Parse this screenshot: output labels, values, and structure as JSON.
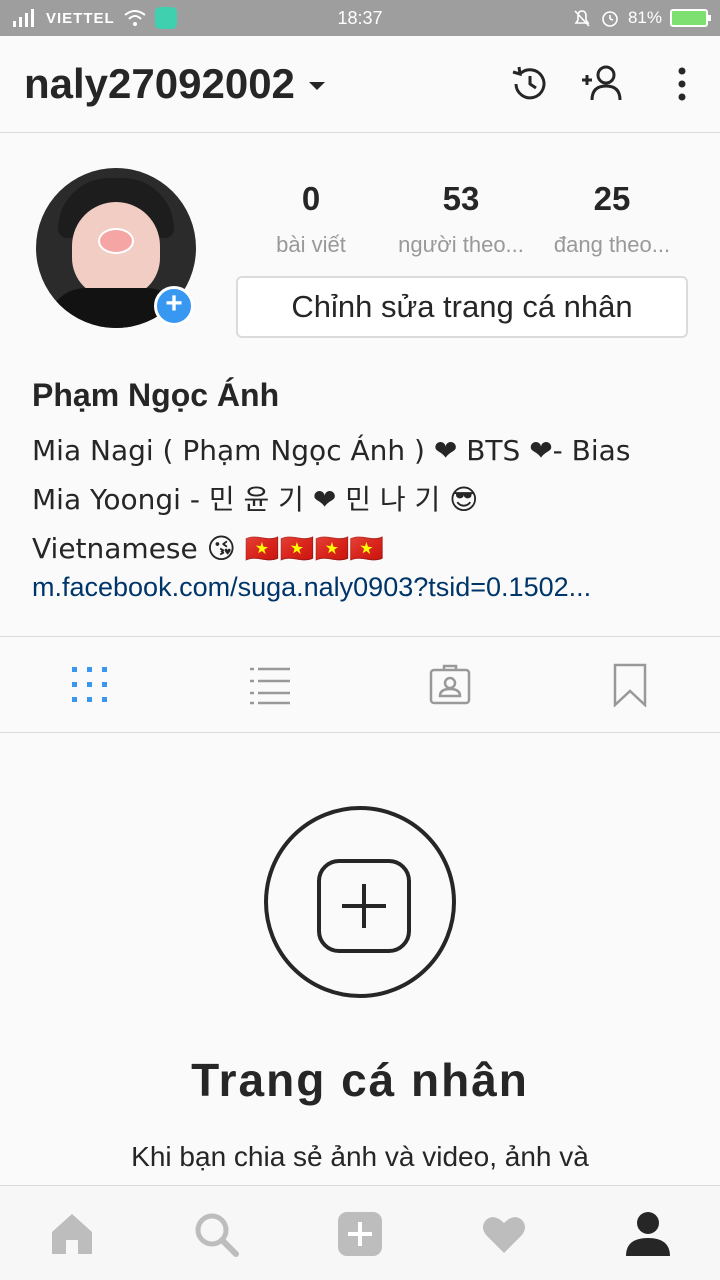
{
  "status_bar": {
    "carrier": "VIETTEL",
    "time": "18:37",
    "battery": "81%"
  },
  "header": {
    "username": "naly27092002"
  },
  "profile": {
    "stats": [
      {
        "value": "0",
        "label": "bài viết"
      },
      {
        "value": "53",
        "label": "người theo..."
      },
      {
        "value": "25",
        "label": "đang theo..."
      }
    ],
    "edit_button_label": "Chỉnh sửa trang cá nhân",
    "full_name": "Phạm Ngọc Ánh",
    "bio_lines": [
      "Mia Nagi ( Phạm Ngọc Ánh ) ❤ BTS ❤- Bias",
      "Mia Yoongi - 민 윤 기 ❤ 민 나 기 😎",
      "Vietnamese 😘 🇻🇳🇻🇳🇻🇳🇻🇳"
    ],
    "link": "m.facebook.com/suga.naly0903?tsid=0.1502..."
  },
  "empty_state": {
    "title": "Trang cá nhân",
    "subtitle": "Khi bạn chia sẻ ảnh và video, ảnh và"
  },
  "colors": {
    "accent_blue": "#3897f0",
    "link_blue": "#003569"
  }
}
